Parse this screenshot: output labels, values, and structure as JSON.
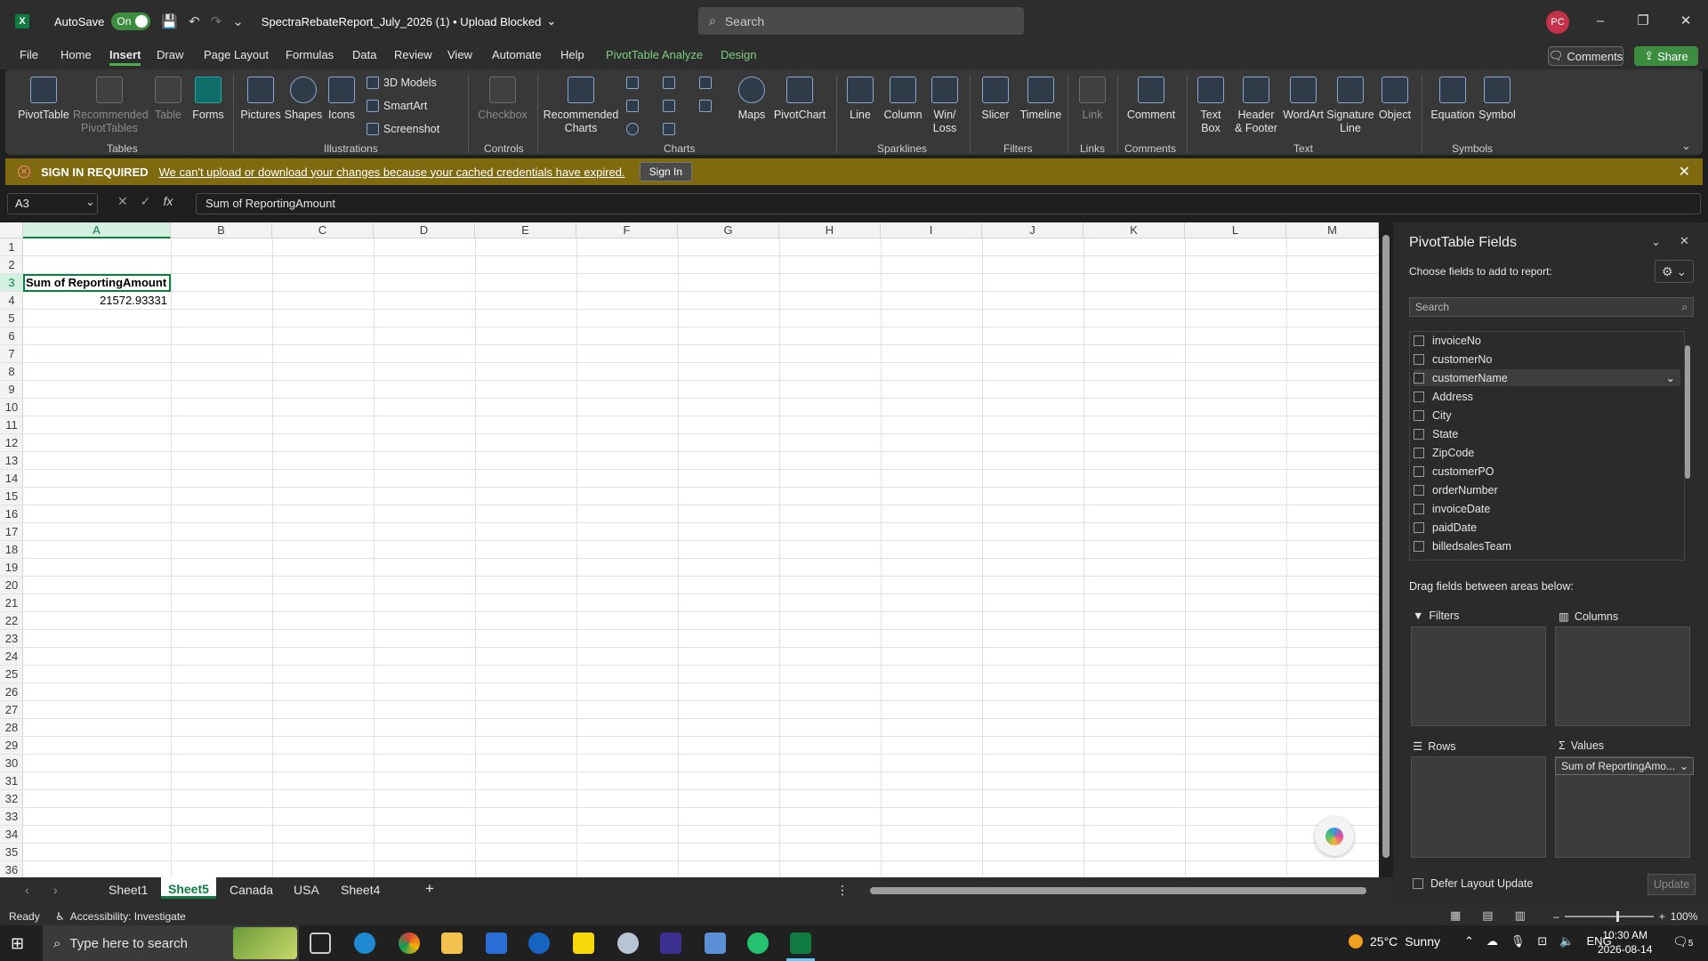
{
  "titlebar": {
    "autosave_label": "AutoSave",
    "autosave_state": "On",
    "doc_title": "SpectraRebateReport_July_2026 (1) • Upload Blocked",
    "search_placeholder": "Search",
    "avatar_initials": "PC"
  },
  "menu": {
    "items": [
      "File",
      "Home",
      "Insert",
      "Draw",
      "Page Layout",
      "Formulas",
      "Data",
      "Review",
      "View",
      "Automate",
      "Help",
      "PivotTable Analyze",
      "Design"
    ],
    "active": "Insert",
    "comments_label": "Comments",
    "share_label": "Share"
  },
  "ribbon": {
    "groups": {
      "tables": "Tables",
      "illustrations": "Illustrations",
      "controls": "Controls",
      "charts": "Charts",
      "sparklines": "Sparklines",
      "filters": "Filters",
      "links": "Links",
      "comments": "Comments",
      "text": "Text",
      "symbols": "Symbols"
    },
    "buttons": {
      "pivottable": "PivotTable",
      "rec_pivot_1": "Recommended",
      "rec_pivot_2": "PivotTables",
      "table": "Table",
      "forms": "Forms",
      "pictures": "Pictures",
      "shapes": "Shapes",
      "icons": "Icons",
      "models3d": "3D Models",
      "smartart": "SmartArt",
      "screenshot": "Screenshot",
      "checkbox": "Checkbox",
      "rec_charts_1": "Recommended",
      "rec_charts_2": "Charts",
      "maps": "Maps",
      "pivotchart": "PivotChart",
      "line": "Line",
      "column": "Column",
      "winloss_1": "Win/",
      "winloss_2": "Loss",
      "slicer": "Slicer",
      "timeline": "Timeline",
      "link": "Link",
      "comment": "Comment",
      "textbox_1": "Text",
      "textbox_2": "Box",
      "header_1": "Header",
      "header_2": "& Footer",
      "wordart": "WordArt",
      "signature_1": "Signature",
      "signature_2": "Line",
      "object": "Object",
      "equation": "Equation",
      "symbol": "Symbol"
    }
  },
  "signin_bar": {
    "title": "SIGN IN REQUIRED",
    "message": "We can't upload or download your changes because your cached credentials have expired.",
    "button": "Sign In"
  },
  "formula_bar": {
    "name_box": "A3",
    "formula": "Sum of ReportingAmount"
  },
  "grid": {
    "columns": [
      "A",
      "B",
      "C",
      "D",
      "E",
      "F",
      "G",
      "H",
      "I",
      "J",
      "K",
      "L",
      "M"
    ],
    "selected_column": "A",
    "rows": [
      "1",
      "2",
      "3",
      "4",
      "5",
      "6",
      "7",
      "8",
      "9",
      "10",
      "11",
      "12",
      "13",
      "14",
      "15",
      "16",
      "17",
      "18",
      "19",
      "20",
      "21",
      "22",
      "23",
      "24",
      "25",
      "26",
      "27",
      "28",
      "29",
      "30",
      "31",
      "32",
      "33",
      "34",
      "35",
      "36"
    ],
    "selected_row": "3",
    "cells": {
      "A3": "Sum of ReportingAmount",
      "A4": "21572.93331"
    }
  },
  "sheets": {
    "tabs": [
      "Sheet1",
      "Sheet5",
      "Canada",
      "USA",
      "Sheet4"
    ],
    "active": "Sheet5"
  },
  "pivot_pane": {
    "title": "PivotTable Fields",
    "subtitle": "Choose fields to add to report:",
    "search_placeholder": "Search",
    "fields": [
      "invoiceNo",
      "customerNo",
      "customerName",
      "Address",
      "City",
      "State",
      "ZipCode",
      "customerPO",
      "orderNumber",
      "invoiceDate",
      "paidDate",
      "billedsalesTeam"
    ],
    "highlighted_field": "customerName",
    "drag_label": "Drag fields between areas below:",
    "areas": {
      "filters": "Filters",
      "columns": "Columns",
      "rows": "Rows",
      "values": "Values"
    },
    "values_chip": "Sum of ReportingAmo...",
    "defer_label": "Defer Layout Update",
    "update_label": "Update"
  },
  "statusbar": {
    "ready": "Ready",
    "accessibility": "Accessibility: Investigate",
    "zoom": "100%"
  },
  "taskbar": {
    "search_placeholder": "Type here to search",
    "temperature": "25°C",
    "weather": "Sunny",
    "language": "ENG",
    "time": "10:30 AM",
    "date": "2026-08-14",
    "notifications": "5"
  },
  "colors": {
    "accent_green": "#107c41",
    "signin_bar": "#7f6a10",
    "context_tab": "#7cd07e"
  }
}
